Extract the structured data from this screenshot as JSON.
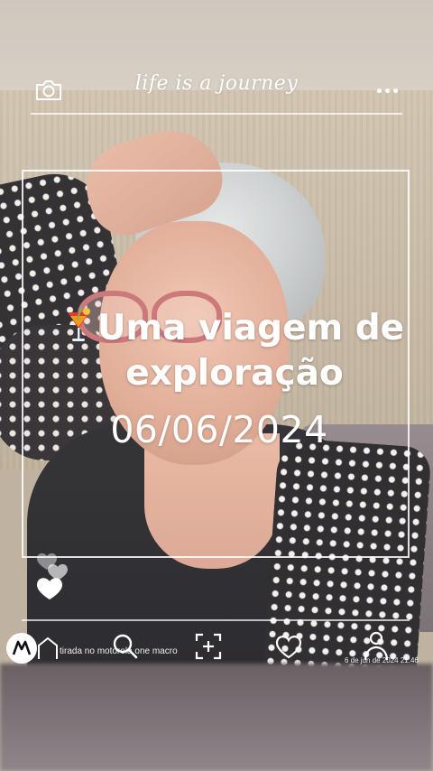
{
  "header": {
    "brand_text": "life is a journey",
    "camera_icon": "camera-icon",
    "more_icon": "more-dots-icon"
  },
  "story": {
    "title_line1": "Uma viagem de",
    "title_line2": "exploração",
    "title_icon": "tropical-drink-icon",
    "date": "06/06/2024"
  },
  "footer": {
    "watermark_left": "tirada no motorola one macro",
    "watermark_right": "6 de jun de 2024 21:46",
    "icons": [
      "motorola-logo-icon",
      "home-icon",
      "search-icon",
      "scan-icon",
      "heart-icon",
      "person-icon"
    ]
  },
  "colors": {
    "overlay_text": "#ffffff",
    "frame_line": "#ffffff",
    "drink_red": "#e23a2b",
    "drink_orange": "#f39a1e"
  }
}
